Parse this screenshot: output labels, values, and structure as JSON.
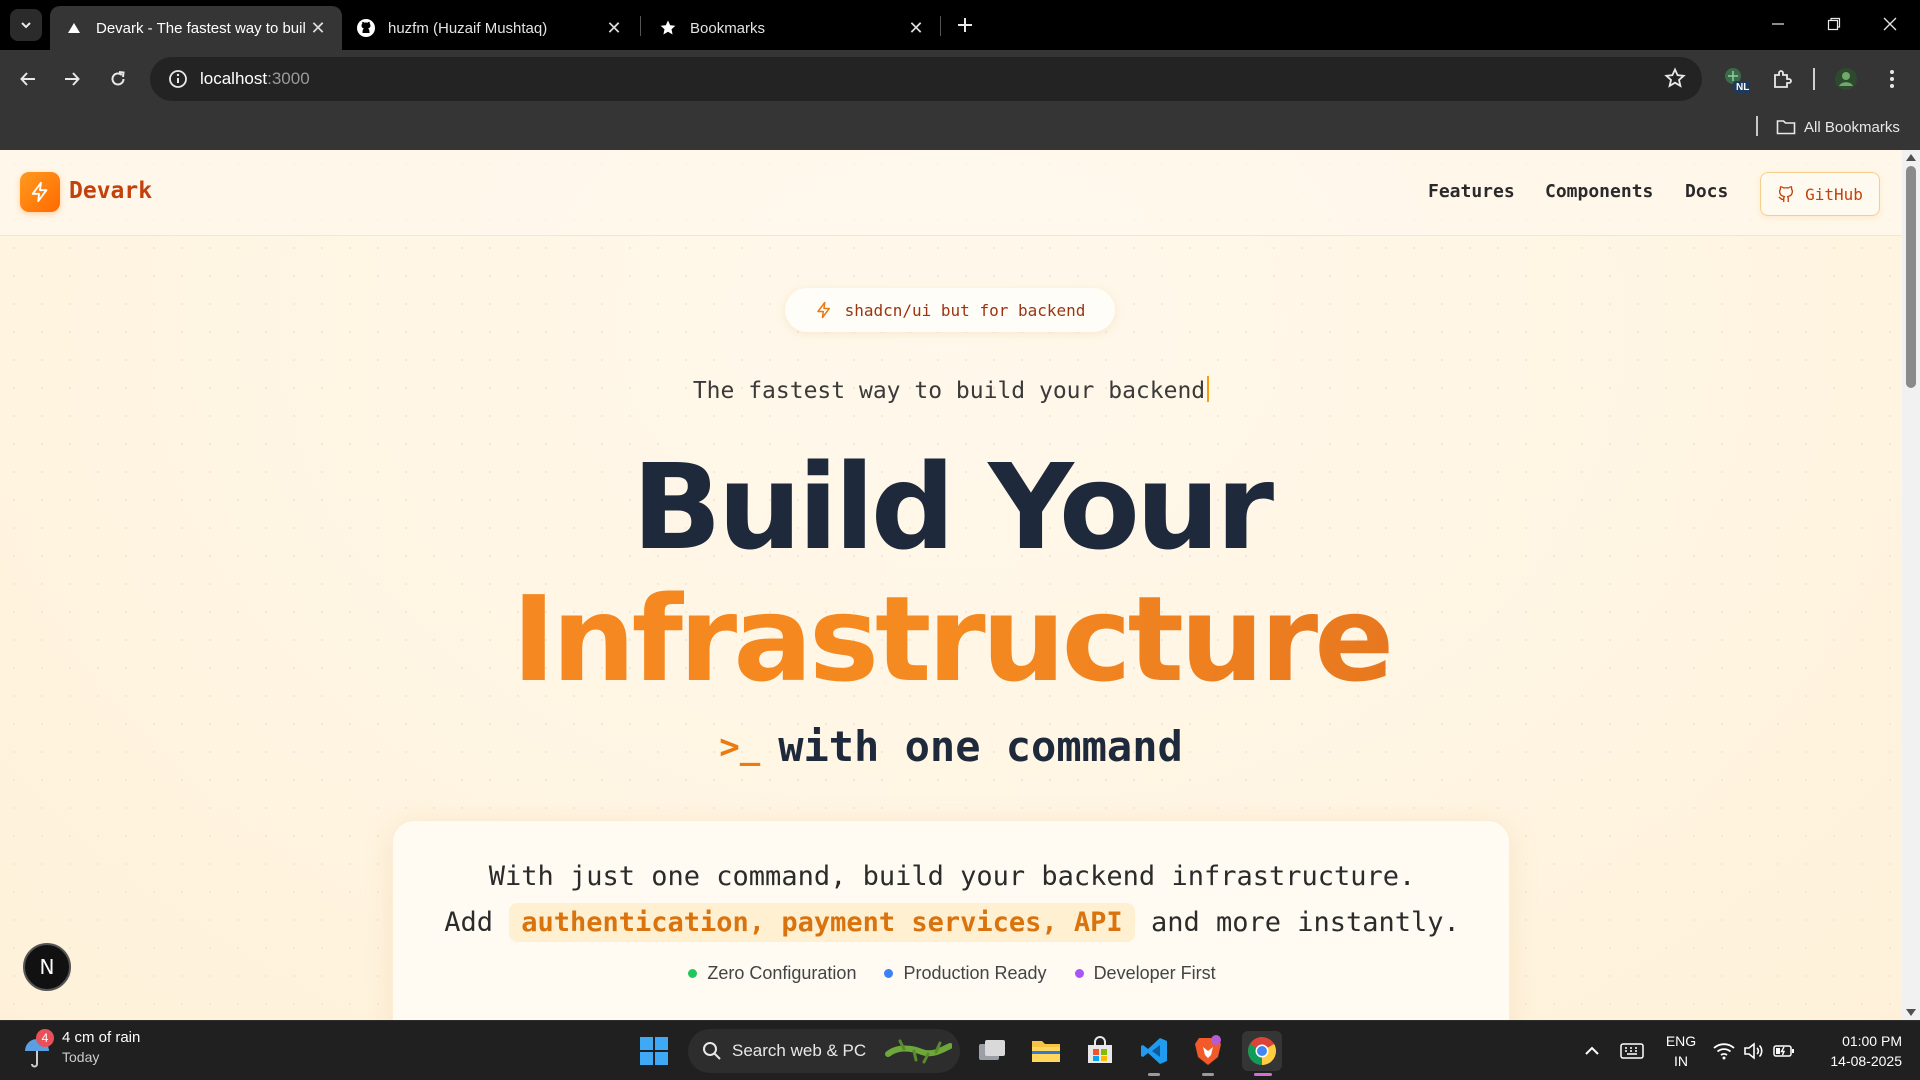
{
  "browser": {
    "tabs": [
      {
        "title": "Devark - The fastest way to buil",
        "active": true,
        "favicon": "vercel-triangle-icon"
      },
      {
        "title": "huzfm (Huzaif Mushtaq)",
        "active": false,
        "favicon": "github-icon"
      },
      {
        "title": "Bookmarks",
        "active": false,
        "favicon": "star-icon"
      }
    ],
    "address": {
      "host": "localhost",
      "port": ":3000"
    },
    "bookmarks_bar": {
      "all_bookmarks": "All Bookmarks"
    },
    "extensions": [
      {
        "badge": "NL"
      }
    ]
  },
  "site": {
    "logo": "Devark",
    "nav": [
      "Features",
      "Components",
      "Docs"
    ],
    "github_label": "GitHub",
    "badge": "shadcn/ui but for backend",
    "tagline": "The fastest way to build your backend",
    "headline_1": "Build Your",
    "headline_2": "Infrastructure",
    "prompt_symbol": ">_",
    "command_text": "with one command",
    "card": {
      "line1": "With just one command, build your backend infrastructure.",
      "line2_prefix": "Add",
      "line2_highlight": "authentication, payment services, API",
      "line2_suffix": "and more instantly."
    },
    "features": [
      {
        "label": "Zero Configuration",
        "color": "#22c55e"
      },
      {
        "label": "Production Ready",
        "color": "#3b82f6"
      },
      {
        "label": "Developer First",
        "color": "#a855f7"
      }
    ],
    "dev_badge": "N",
    "accent": "#f5851f",
    "dark": "#1e293b"
  },
  "taskbar": {
    "weather": {
      "badge_count": "4",
      "text": "4 cm of rain",
      "sub": "Today"
    },
    "search_placeholder": "Search web & PC",
    "language": {
      "line1": "ENG",
      "line2": "IN"
    },
    "clock": {
      "time": "01:00 PM",
      "date": "14-08-2025"
    }
  }
}
